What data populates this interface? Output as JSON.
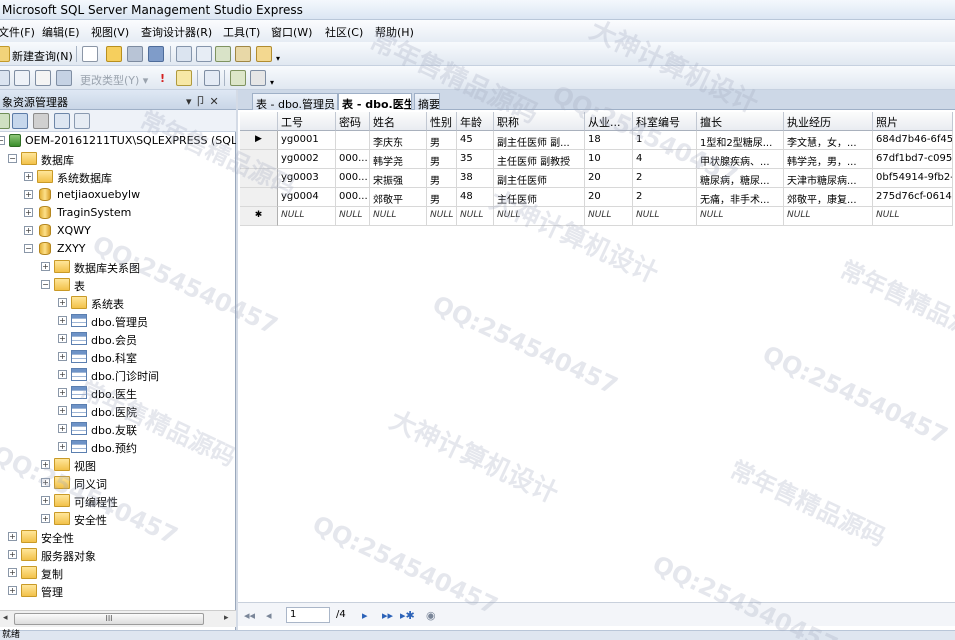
{
  "window": {
    "title": "Microsoft SQL Server Management Studio Express"
  },
  "menu": [
    "文件(F)",
    "编辑(E)",
    "视图(V)",
    "查询设计器(R)",
    "工具(T)",
    "窗口(W)",
    "社区(C)",
    "帮助(H)"
  ],
  "toolbar": {
    "new_query": "新建查询(N)",
    "change_type": "更改类型(Y) ▾"
  },
  "explorer": {
    "title": "象资源管理器",
    "pin": "▾ 卩 ✕",
    "tree": {
      "server": "OEM-20161211TUX\\SQLEXPRESS (SQL Se",
      "databases": "数据库",
      "system_db": "系统数据库",
      "db1": "netjiaoxuebylw",
      "db2": "TraginSystem",
      "db3": "XQWY",
      "db4": "ZXYY",
      "diagrams": "数据库关系图",
      "tables": "表",
      "system_tables": "系统表",
      "t1": "dbo.管理员",
      "t2": "dbo.会员",
      "t3": "dbo.科室",
      "t4": "dbo.门诊时间",
      "t5": "dbo.医生",
      "t6": "dbo.医院",
      "t7": "dbo.友联",
      "t8": "dbo.预约",
      "views": "视图",
      "synonyms": "同义词",
      "programmability": "可编程性",
      "security_db": "安全性",
      "security": "安全性",
      "server_objects": "服务器对象",
      "replication": "复制",
      "management": "管理"
    },
    "scroll_label": "III"
  },
  "tabs": [
    "表 - dbo.管理员",
    "表 - dbo.医生",
    "摘要"
  ],
  "grid": {
    "columns": [
      "工号",
      "密码",
      "姓名",
      "性别",
      "年龄",
      "职称",
      "从业...",
      "科室编号",
      "擅长",
      "执业经历",
      "照片"
    ],
    "rows": [
      {
        "marker": "▶",
        "cells": [
          "yg0001",
          "",
          "李庆东",
          "男",
          "45",
          "副主任医师 副...",
          "18",
          "1",
          "1型和2型糖尿...",
          "李文慧，女，...",
          "684d7b46-6f45-..."
        ]
      },
      {
        "marker": "",
        "cells": [
          "yg0002",
          "000...",
          "韩学尧",
          "男",
          "35",
          "主任医师 副教授",
          "10",
          "4",
          "甲状腺疾病、...",
          "韩学尧，男，...",
          "67df1bd7-c095-..."
        ]
      },
      {
        "marker": "",
        "cells": [
          "yg0003",
          "000...",
          "宋振强",
          "男",
          "38",
          "副主任医师",
          "20",
          "2",
          "糖尿病，糖尿...",
          "天津市糖尿病...",
          "0bf54914-9fb2-..."
        ]
      },
      {
        "marker": "",
        "cells": [
          "yg0004",
          "000...",
          "郊敬平",
          "男",
          "48",
          "主任医师",
          "20",
          "2",
          "无痛，非手术...",
          "郊敬平，康复...",
          "275d76cf-0614-..."
        ]
      },
      {
        "marker": "✱",
        "cells": [
          "NULL",
          "NULL",
          "NULL",
          "NULL",
          "NULL",
          "NULL",
          "NULL",
          "NULL",
          "NULL",
          "NULL",
          "NULL"
        ]
      }
    ]
  },
  "navigator": {
    "first": "◂◂",
    "prev": "◂",
    "current_page": "1",
    "total": "/4",
    "next": "▸",
    "last": "▸▸",
    "new": "▸✱",
    "stop": "◉"
  },
  "status": "就绪",
  "watermarks": [
    "常年售精品源码",
    "大神计算机设计",
    "QQ:254540457"
  ]
}
